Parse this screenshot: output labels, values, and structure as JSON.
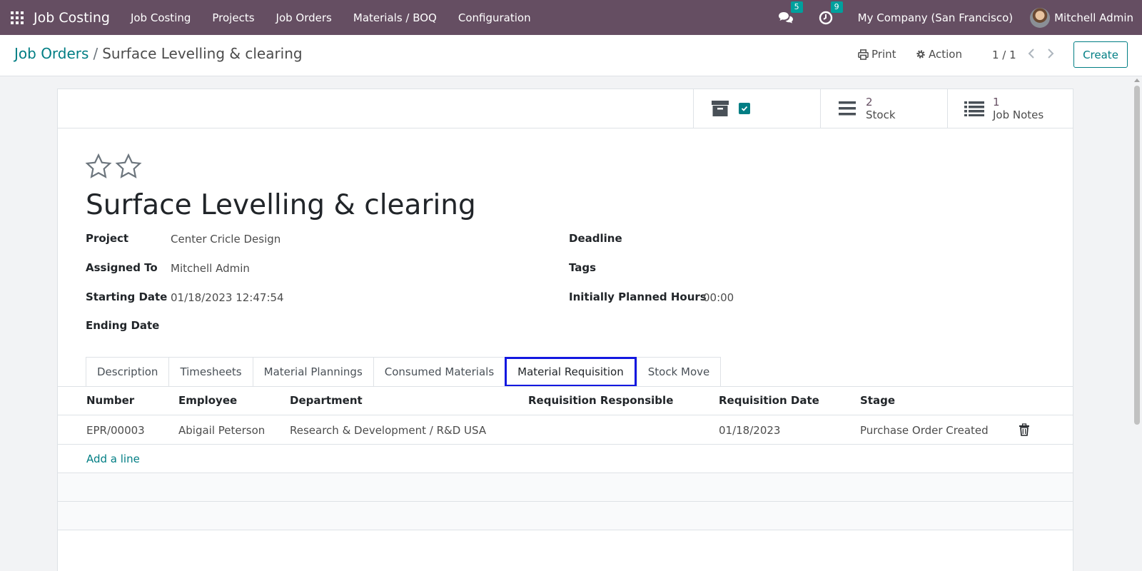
{
  "navbar": {
    "app_name": "Job Costing",
    "menu": [
      "Job Costing",
      "Projects",
      "Job Orders",
      "Materials / BOQ",
      "Configuration"
    ],
    "messages_count": "5",
    "activities_count": "9",
    "company": "My Company (San Francisco)",
    "user": "Mitchell Admin"
  },
  "breadcrumb": {
    "parent": "Job Orders",
    "separator": "/",
    "current": "Surface Levelling & clearing"
  },
  "toolbar": {
    "print_label": "Print",
    "action_label": "Action",
    "pager": "1 / 1",
    "create_label": "Create"
  },
  "smart_buttons": {
    "stock_count": "2",
    "stock_label": "Stock",
    "notes_count": "1",
    "notes_label": "Job Notes"
  },
  "record": {
    "title": "Surface Levelling & clearing",
    "fields_left": [
      {
        "label": "Project",
        "value": "Center Cricle Design"
      },
      {
        "label": "Assigned To",
        "value": "Mitchell Admin"
      },
      {
        "label": "Starting Date",
        "value": "01/18/2023 12:47:54"
      },
      {
        "label": "Ending Date",
        "value": ""
      }
    ],
    "fields_right": [
      {
        "label": "Deadline",
        "value": ""
      },
      {
        "label": "Tags",
        "value": ""
      },
      {
        "label": "Initially Planned Hours",
        "value": "00:00"
      }
    ]
  },
  "tabs": [
    "Description",
    "Timesheets",
    "Material Plannings",
    "Consumed Materials",
    "Material Requisition",
    "Stock Move"
  ],
  "active_tab": "Material Requisition",
  "table": {
    "headers": [
      "Number",
      "Employee",
      "Department",
      "Requisition Responsible",
      "Requisition Date",
      "Stage"
    ],
    "rows": [
      [
        "EPR/00003",
        "Abigail Peterson",
        "Research & Development / R&D USA",
        "",
        "01/18/2023",
        "Purchase Order Created"
      ]
    ],
    "add_line": "Add a line"
  },
  "colors": {
    "navbar": "#654e62",
    "accent": "#017e84",
    "badge": "#00a09d",
    "active_tab_outline": "#1318e0"
  }
}
